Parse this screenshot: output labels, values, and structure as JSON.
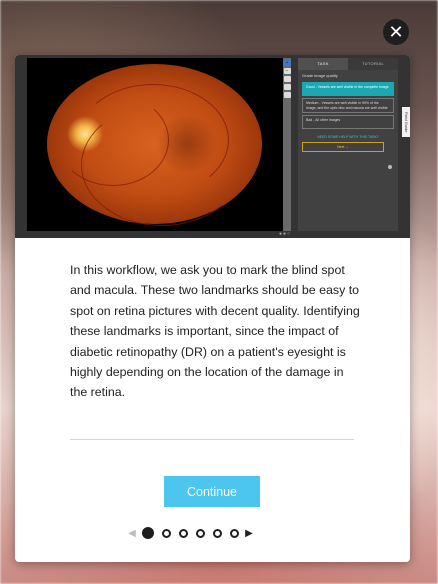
{
  "close": {
    "icon": "close-icon",
    "glyph": "✕"
  },
  "preview": {
    "toolbar_tools": [
      "+",
      "−",
      "",
      "",
      ""
    ],
    "tabs": [
      "TASK",
      "TUTORIAL"
    ],
    "question": "Grade image quality",
    "answers": [
      "Good - Vessels are well visible in the complete image",
      "Medium - Vessels are well visible in 90% of the image, and the optic disc and macula are well visible",
      "Bad - All other images"
    ],
    "selected_answer": 0,
    "help_link": "NEED SOME HELP WITH THIS TASK?",
    "next_label": "Next →",
    "field_guide": "Field Guide"
  },
  "content": {
    "description": "In this workflow, we ask you to mark the blind spot and macula. These two landmarks should be easy to spot on retina pictures with decent quality. Identifying these landmarks is important, since the impact of diabetic retinopathy (DR) on a patient's eyesight is highly depending on the location of the damage in the retina."
  },
  "actions": {
    "continue_label": "Continue"
  },
  "pagination": {
    "prev_glyph": "◀",
    "next_glyph": "▶",
    "pages": 6,
    "current": 1
  },
  "colors": {
    "accent": "#4cc5ef",
    "selected_answer": "#1aa9b3",
    "next_button": "#c9a11a"
  }
}
